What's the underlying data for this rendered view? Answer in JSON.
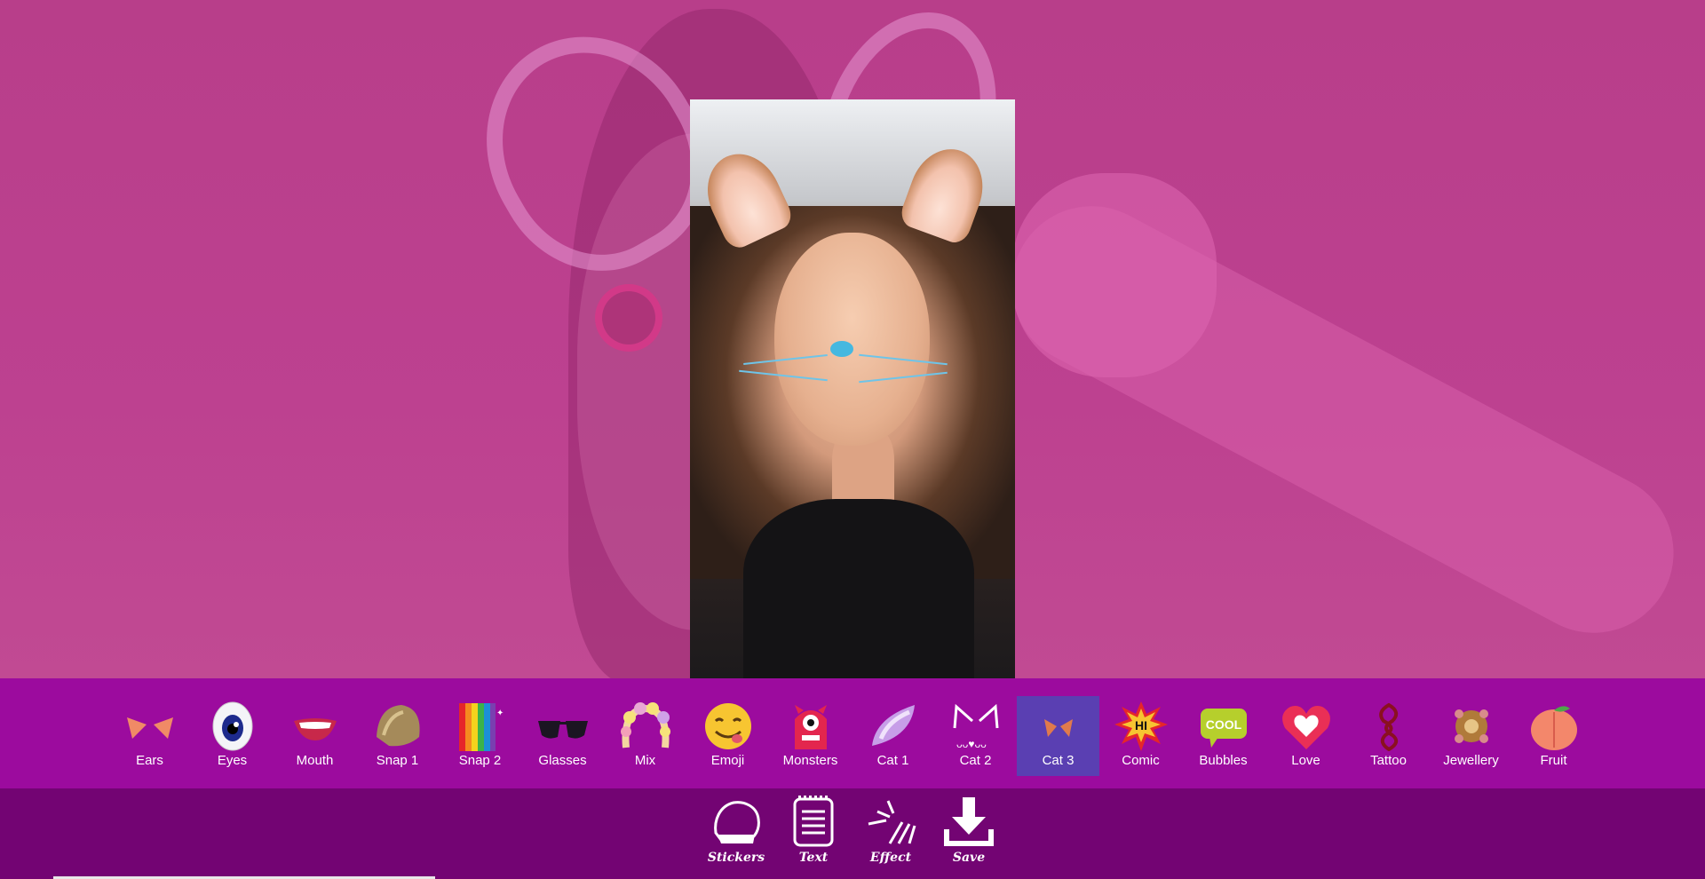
{
  "stickers": [
    {
      "label": "Ears",
      "icon": "ears-icon"
    },
    {
      "label": "Eyes",
      "icon": "eyes-icon"
    },
    {
      "label": "Mouth",
      "icon": "mouth-icon"
    },
    {
      "label": "Snap 1",
      "icon": "snap1-icon"
    },
    {
      "label": "Snap 2",
      "icon": "snap2-icon"
    },
    {
      "label": "Glasses",
      "icon": "glasses-icon"
    },
    {
      "label": "Mix",
      "icon": "mix-icon"
    },
    {
      "label": "Emoji",
      "icon": "emoji-icon"
    },
    {
      "label": "Monsters",
      "icon": "monsters-icon"
    },
    {
      "label": "Cat 1",
      "icon": "cat1-icon"
    },
    {
      "label": "Cat 2",
      "icon": "cat2-icon"
    },
    {
      "label": "Cat 3",
      "icon": "cat3-icon",
      "selected": true
    },
    {
      "label": "Comic",
      "icon": "comic-icon"
    },
    {
      "label": "Bubbles",
      "icon": "bubbles-icon"
    },
    {
      "label": "Love",
      "icon": "love-icon"
    },
    {
      "label": "Tattoo",
      "icon": "tattoo-icon"
    },
    {
      "label": "Jewellery",
      "icon": "jewellery-icon"
    },
    {
      "label": "Fruit",
      "icon": "fruit-icon"
    }
  ],
  "comic_text": "HI",
  "bubble_text": "COOL",
  "tools": [
    {
      "label": "Stickers",
      "icon": "stickers-icon"
    },
    {
      "label": "Text",
      "icon": "text-icon"
    },
    {
      "label": "Effect",
      "icon": "effect-icon"
    },
    {
      "label": "Save",
      "icon": "save-icon"
    }
  ],
  "colors": {
    "sticker_bar": "#9c0b9e",
    "tool_bar": "#730473",
    "selected": "#5a3fb2",
    "background": "#c0458f"
  }
}
